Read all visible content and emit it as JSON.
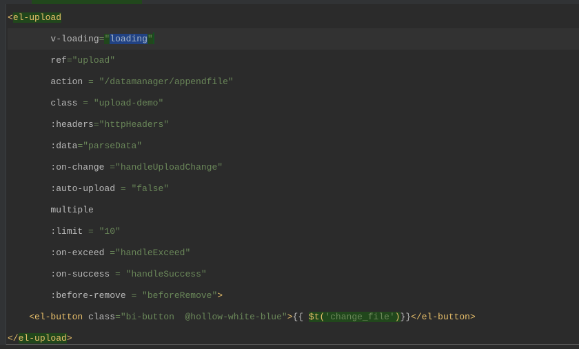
{
  "code": {
    "lines": [
      {
        "indent": 0,
        "segments": [
          {
            "cls": "tag",
            "text": "<"
          },
          {
            "cls": "hi-green",
            "text": "el-upload"
          }
        ]
      },
      {
        "indent": 8,
        "current": true,
        "segments": [
          {
            "cls": "attr",
            "text": "v-loading"
          },
          {
            "cls": "str",
            "text": "="
          },
          {
            "cls": "hi-green2",
            "text": "\""
          },
          {
            "cls": "sel",
            "text": "loading"
          },
          {
            "cls": "hi-green2",
            "text": "\""
          },
          {
            "cls": "caret-bg",
            "text": ""
          }
        ]
      },
      {
        "indent": 8,
        "segments": [
          {
            "cls": "attr",
            "text": "ref"
          },
          {
            "cls": "str",
            "text": "=\"upload\""
          }
        ]
      },
      {
        "indent": 8,
        "segments": [
          {
            "cls": "attr",
            "text": "action "
          },
          {
            "cls": "str",
            "text": "= \"/datamanager/appendfile\""
          }
        ]
      },
      {
        "indent": 8,
        "segments": [
          {
            "cls": "attr",
            "text": "class "
          },
          {
            "cls": "str",
            "text": "= \"upload-demo\""
          }
        ]
      },
      {
        "indent": 8,
        "segments": [
          {
            "cls": "attr",
            "text": ":headers"
          },
          {
            "cls": "str",
            "text": "=\"httpHeaders\""
          }
        ]
      },
      {
        "indent": 8,
        "segments": [
          {
            "cls": "attr",
            "text": ":data"
          },
          {
            "cls": "str",
            "text": "=\"parseData\""
          }
        ]
      },
      {
        "indent": 8,
        "segments": [
          {
            "cls": "attr",
            "text": ":on-change "
          },
          {
            "cls": "str",
            "text": "=\"handleUploadChange\""
          }
        ]
      },
      {
        "indent": 8,
        "segments": [
          {
            "cls": "attr",
            "text": ":auto-upload "
          },
          {
            "cls": "str",
            "text": "= \"false\""
          }
        ]
      },
      {
        "indent": 8,
        "segments": [
          {
            "cls": "attr",
            "text": "multiple"
          }
        ]
      },
      {
        "indent": 8,
        "segments": [
          {
            "cls": "attr",
            "text": ":limit "
          },
          {
            "cls": "str",
            "text": "= \"10\""
          }
        ]
      },
      {
        "indent": 8,
        "segments": [
          {
            "cls": "attr",
            "text": ":on-exceed "
          },
          {
            "cls": "str",
            "text": "=\"handleExceed\""
          }
        ]
      },
      {
        "indent": 8,
        "segments": [
          {
            "cls": "attr",
            "text": ":on-success "
          },
          {
            "cls": "str",
            "text": "= \"handleSuccess\""
          }
        ]
      },
      {
        "indent": 8,
        "segments": [
          {
            "cls": "attr",
            "text": ":before-remove "
          },
          {
            "cls": "str",
            "text": "= \"beforeRemove\""
          },
          {
            "cls": "tag",
            "text": ">"
          }
        ]
      },
      {
        "indent": 4,
        "segments": [
          {
            "cls": "tag",
            "text": "<el-button "
          },
          {
            "cls": "attr",
            "text": "class"
          },
          {
            "cls": "str",
            "text": "=\"bi-button  @hollow-white-blue\""
          },
          {
            "cls": "tag",
            "text": ">"
          },
          {
            "cls": "attr",
            "text": "{{ "
          },
          {
            "cls": "hi-green",
            "text": "$t("
          },
          {
            "cls": "hi-green2",
            "text": "'change_file'"
          },
          {
            "cls": "hi-green",
            "text": ")"
          },
          {
            "cls": "attr",
            "text": "}}"
          },
          {
            "cls": "tag",
            "text": "</el-button>"
          }
        ]
      },
      {
        "indent": 0,
        "segments": [
          {
            "cls": "tag",
            "text": "</"
          },
          {
            "cls": "hi-green",
            "text": "el-upload"
          },
          {
            "cls": "tag",
            "text": ">"
          }
        ]
      }
    ]
  }
}
